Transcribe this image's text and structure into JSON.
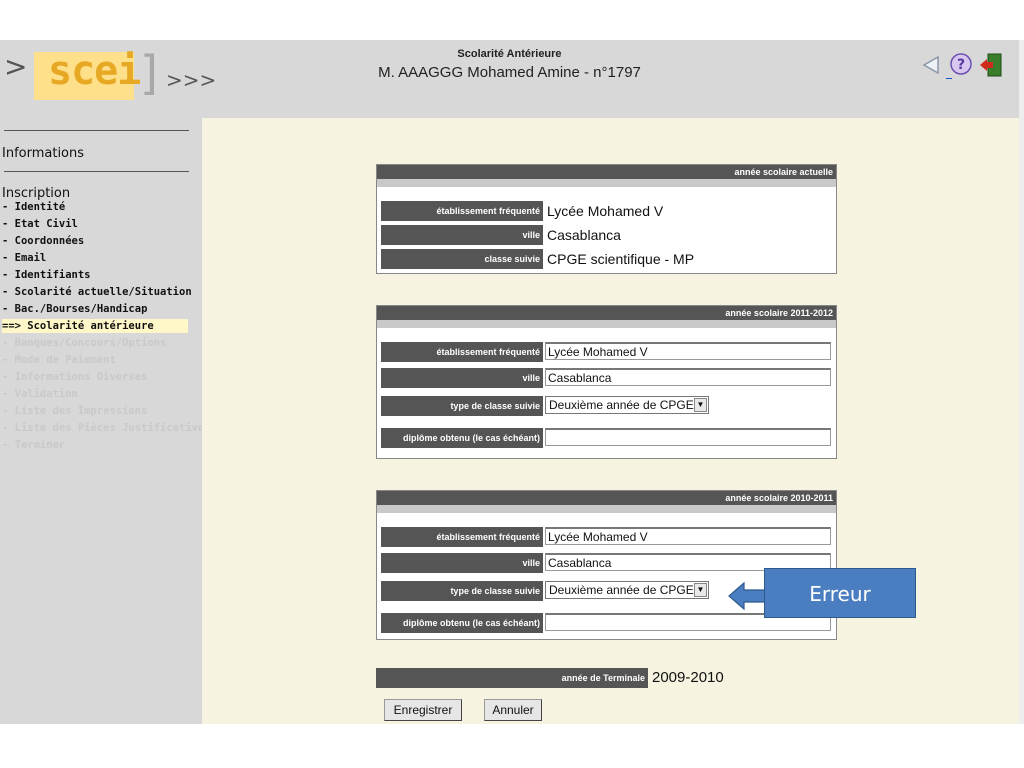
{
  "logo": {
    "open": "[",
    "word": "scei",
    "close": "]",
    "left": ">",
    "chevrons": ">>>"
  },
  "header": {
    "subtitle": "Scolarité Antérieure",
    "name": "M. AAAGGG Mohamed Amine - n°1797"
  },
  "sidebar": {
    "informations": "Informations",
    "inscription": "Inscription",
    "items": [
      {
        "label": "-  Identité",
        "state": "active"
      },
      {
        "label": "-  Etat Civil",
        "state": "active"
      },
      {
        "label": "-  Coordonnées",
        "state": "active"
      },
      {
        "label": "-  Email",
        "state": "active"
      },
      {
        "label": "-  Identifiants",
        "state": "active"
      },
      {
        "label": "-  Scolarité actuelle/Situation",
        "state": "active"
      },
      {
        "label": "-  Bac./Bourses/Handicap",
        "state": "active"
      },
      {
        "label": "==>  Scolarité antérieure",
        "state": "current"
      },
      {
        "label": "-  Banques/Concours/Options",
        "state": "disabled"
      },
      {
        "label": "-  Mode de Paiement",
        "state": "disabled"
      },
      {
        "label": "-  Informations Diverses",
        "state": "disabled"
      },
      {
        "label": "-  Validation",
        "state": "disabled"
      },
      {
        "label": "-  Liste des Impressions",
        "state": "disabled"
      },
      {
        "label": "-  Liste des Pièces Justificatives",
        "state": "disabled"
      },
      {
        "label": "-  Terminer",
        "state": "disabled"
      }
    ]
  },
  "current_year": {
    "title": "année scolaire actuelle",
    "etab_label": "établissement fréquenté",
    "etab": "Lycée Mohamed V",
    "ville_label": "ville",
    "ville": "Casablanca",
    "classe_label": "classe suivie",
    "classe": "CPGE scientifique - MP"
  },
  "year_2011": {
    "title": "année scolaire 2011-2012",
    "etab_label": "établissement fréquenté",
    "etab": "Lycée Mohamed V",
    "ville_label": "ville",
    "ville": "Casablanca",
    "type_label": "type de classe suivie",
    "type": "Deuxième année de CPGE",
    "diplome_label": "diplôme obtenu (le cas échéant)",
    "diplome": ""
  },
  "year_2010": {
    "title": "année scolaire 2010-2011",
    "etab_label": "établissement fréquenté",
    "etab": "Lycée Mohamed V",
    "ville_label": "ville",
    "ville": "Casablanca",
    "type_label": "type de classe suivie",
    "type": "Deuxième année de CPGE",
    "diplome_label": "diplôme obtenu (le cas échéant)",
    "diplome": ""
  },
  "terminale": {
    "label": "année de Terminale",
    "value": "2009-2010"
  },
  "buttons": {
    "save": "Enregistrer",
    "cancel": "Annuler"
  },
  "callout": {
    "text": "Erreur",
    "color": "#4a7ec0"
  },
  "icons": [
    "back-icon",
    "help-icon",
    "exit-icon"
  ]
}
